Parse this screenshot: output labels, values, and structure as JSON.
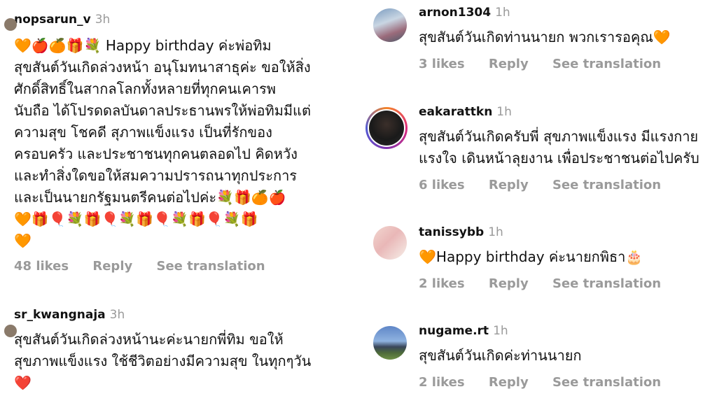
{
  "left": [
    {
      "username": "nopsarun_v",
      "time": "3h",
      "lines": [
        "🧡🍎🍊🎁💐 Happy birthday ค่ะพ่อทิม",
        "สุขสันต์วันเกิดล่วงหน้า อนุโมทนาสาธุค่ะ ขอให้สิ่ง",
        "ศักดิ์สิทธิ์ในสากลโลกทั้งหลายที่ทุกคนเคารพ",
        "นับถือ ได้โปรดดลบันดาลประธานพรให้พ่อทิมมีแต่",
        "ความสุข โชคดี สุภาพแข็งแรง เป็นที่รักของ",
        "ครอบครัว และประชาชนทุกคนตลอดไป คิดหวัง",
        "และทำสิ่งใดขอให้สมความปรารถนาทุกประการ",
        "และเป็นนายกรัฐมนตรีคนต่อไปค่ะ💐🎁🍊🍎",
        "🧡🎁🎈💐🎁🎈💐🎁🎈💐🎁🎈💐🎁",
        "🧡"
      ],
      "likes": "48 likes",
      "reply": "Reply",
      "translate": "See translation"
    },
    {
      "username": "sr_kwangnaja",
      "time": "3h",
      "lines": [
        "สุขสันต์วันเกิดล่วงหน้านะค่ะนายกพี่ทิม  ขอให้",
        "สุขภาพแข็งแรง ใช้ชีวิตอย่างมีความสุข ในทุกๆวัน",
        "❤️"
      ]
    }
  ],
  "right": [
    {
      "username": "arnon1304",
      "time": "1h",
      "text": "สุขสันต์วันเกิดท่านนายก พวกเรารอคุณ🧡",
      "likes": "3 likes",
      "reply": "Reply",
      "translate": "See translation"
    },
    {
      "username": "eakarattkn",
      "time": "1h",
      "lines": [
        "สุขสันต์วันเกิดครับพี่ สุขภาพแข็งแรง มีแรงกาย",
        "แรงใจ เดินหน้าลุยงาน เพื่อประชาชนต่อไปครับ"
      ],
      "likes": "6 likes",
      "reply": "Reply",
      "translate": "See translation"
    },
    {
      "username": "tanissybb",
      "time": "1h",
      "text": "🧡Happy birthday ค่ะนายกพิธา🎂",
      "likes": "2 likes",
      "reply": "Reply",
      "translate": "See translation"
    },
    {
      "username": "nugame.rt",
      "time": "1h",
      "text": "สุขสันต์วันเกิดค่ะท่านนายก",
      "likes": "2 likes",
      "reply": "Reply",
      "translate": "See translation"
    }
  ]
}
